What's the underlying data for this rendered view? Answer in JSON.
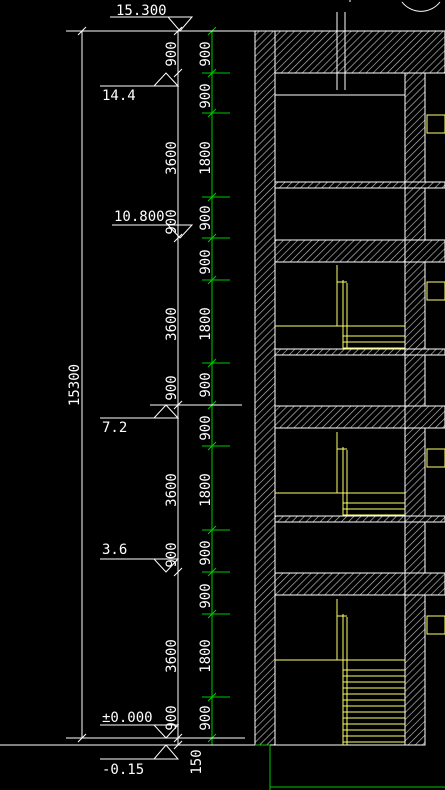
{
  "drawing": {
    "elevation_labels": [
      "15.300",
      "14.4",
      "10.800",
      "7.2",
      "3.6",
      "±0.000",
      "-0.15"
    ],
    "overall_dimension": "15300",
    "mid_dimensions": [
      "900",
      "3600",
      "900",
      "3600",
      "900",
      "3600",
      "900",
      "3600",
      "900"
    ],
    "inner_dimensions": [
      "900",
      "900",
      "1800",
      "900",
      "900",
      "1800",
      "900",
      "900",
      "1800",
      "900",
      "900",
      "1800",
      "900",
      "150"
    ],
    "colors": {
      "background": "#000000",
      "dimension_lines": "#ffffff",
      "grid_lines": "#00c800",
      "walls": "#ffffff",
      "stairs": "#ffff66"
    }
  }
}
